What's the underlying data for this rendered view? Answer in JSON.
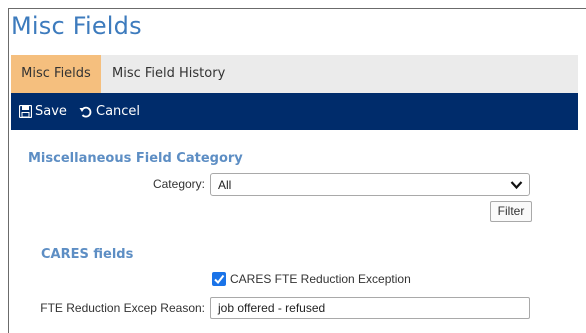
{
  "page": {
    "title": "Misc Fields"
  },
  "tabs": [
    {
      "label": "Misc Fields",
      "active": true
    },
    {
      "label": "Misc Field History",
      "active": false
    }
  ],
  "toolbar": {
    "save_label": "Save",
    "cancel_label": "Cancel"
  },
  "colors": {
    "title": "#3d7bbd",
    "active_tab": "#f5bf7e",
    "toolbar": "#002c6b",
    "heading": "#5d8ec4",
    "checkbox": "#1a73e8"
  },
  "misc_category": {
    "heading": "Miscellaneous Field Category",
    "category_label": "Category:",
    "category_value": "All",
    "filter_label": "Filter"
  },
  "cares": {
    "heading": "CARES fields",
    "checkbox_label": "CARES FTE Reduction Exception",
    "checkbox_checked": true,
    "reason_label": "FTE Reduction Excep Reason:",
    "reason_value": "job offered - refused"
  }
}
